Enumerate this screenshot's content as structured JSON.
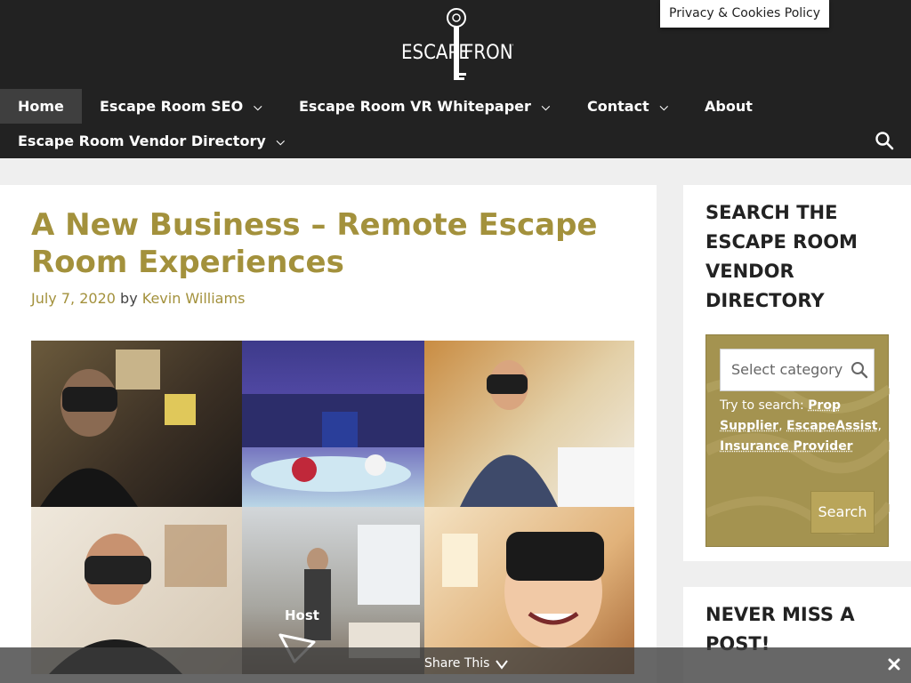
{
  "header": {
    "logo_text_left": "ESCAPE",
    "logo_text_right": "FRONT",
    "privacy_link": "Privacy & Cookies Policy",
    "brand_bg": "#222222",
    "accent": "#a3913c"
  },
  "nav": {
    "items": [
      {
        "label": "Home",
        "dropdown": false,
        "active": true
      },
      {
        "label": "Escape Room SEO",
        "dropdown": true
      },
      {
        "label": "Escape Room VR Whitepaper",
        "dropdown": true
      },
      {
        "label": "Contact",
        "dropdown": true
      },
      {
        "label": "About",
        "dropdown": false
      },
      {
        "label": "Escape Room Vendor Directory",
        "dropdown": true
      }
    ],
    "search_icon": "search-icon"
  },
  "post": {
    "title": "A New Business – Remote Escape Room Experiences",
    "date": "July 7, 2020",
    "by": "by",
    "author": "Kevin Williams",
    "image_overlay_label": "Host"
  },
  "sidebar": {
    "widget1_title": "SEARCH THE ESCAPE ROOM VENDOR DIRECTORY",
    "category_placeholder": "Select category",
    "try_prefix": "Try to search:",
    "suggestions": [
      "Prop Supplier",
      "EscapeAssist",
      "Insurance Provider"
    ],
    "search_button": "Search",
    "widget2_title": "NEVER MISS A POST!"
  },
  "share": {
    "label": "Share This",
    "close_icon": "close-icon"
  }
}
